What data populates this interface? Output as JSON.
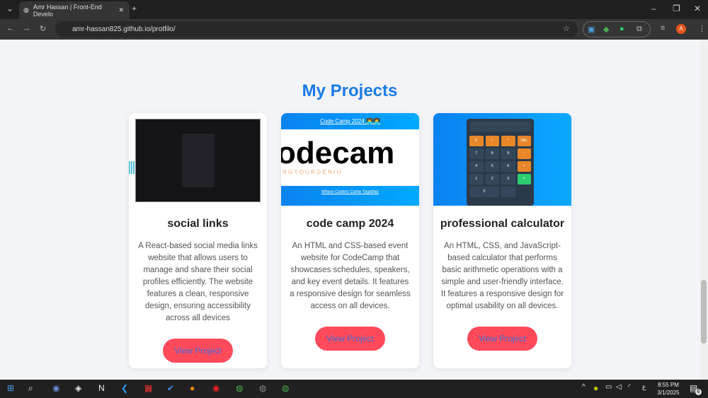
{
  "browser": {
    "tab_title": "Amr Hassan | Front-End Develo",
    "url": "amr-hassan825.github.io/protfilo/",
    "profile_initial": "A"
  },
  "page": {
    "heading": "My Projects",
    "projects": [
      {
        "title": "social links",
        "description": "A React-based social media links website that allows users to manage and share their social profiles efficiently. The website features a clean, responsive design, ensuring accessibility across all devices",
        "button": "View Project"
      },
      {
        "title": "code camp 2024",
        "description": "An HTML and CSS-based event website for CodeCamp that showcases schedules, speakers, and key event details. It features a responsive design for seamless access on all devices.",
        "button": "View Project",
        "thumb_title": "Code Camp 2024 👨‍💻👩‍💻",
        "thumb_logo": "odecam",
        "thumb_tagline": "N G  Y O U R  G E N I U",
        "thumb_footer": "Where Coders Come Together"
      },
      {
        "title": "professional calculator",
        "description": "An HTML, CSS, and JavaScript-based calculator that performs basic arithmetic operations with a simple and user-friendly interface. It features a responsive design for optimal usability on all devices.",
        "button": "View Project",
        "calc_keys": [
          "C",
          "/",
          "*",
          "DEL",
          "7",
          "8",
          "9",
          "-",
          "4",
          "5",
          "6",
          "+",
          "1",
          "2",
          "3",
          "=",
          "0",
          "."
        ]
      }
    ]
  },
  "taskbar": {
    "time": "8:55 PM",
    "date": "3/1/2025",
    "lang": "ع",
    "notifications": "6"
  }
}
